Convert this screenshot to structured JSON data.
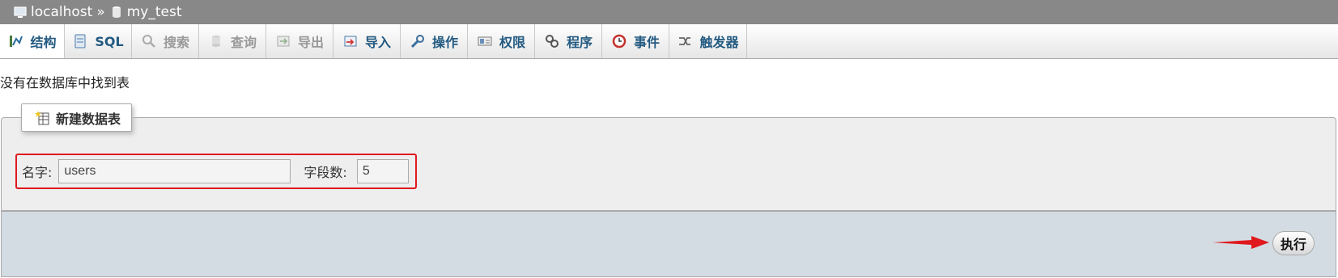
{
  "breadcrumb": {
    "server": "localhost",
    "separator": "»",
    "database": "my_test"
  },
  "tabs": [
    {
      "label": "结构",
      "icon": "structure-icon",
      "enabled": true,
      "active": true
    },
    {
      "label": "SQL",
      "icon": "sql-icon",
      "enabled": true
    },
    {
      "label": "搜索",
      "icon": "search-icon",
      "enabled": false
    },
    {
      "label": "查询",
      "icon": "query-icon",
      "enabled": false
    },
    {
      "label": "导出",
      "icon": "export-icon",
      "enabled": false
    },
    {
      "label": "导入",
      "icon": "import-icon",
      "enabled": true
    },
    {
      "label": "操作",
      "icon": "wrench-icon",
      "enabled": true
    },
    {
      "label": "权限",
      "icon": "privileges-icon",
      "enabled": true
    },
    {
      "label": "程序",
      "icon": "routines-icon",
      "enabled": true
    },
    {
      "label": "事件",
      "icon": "clock-icon",
      "enabled": true
    },
    {
      "label": "触发器",
      "icon": "triggers-icon",
      "enabled": true
    }
  ],
  "message": "没有在数据库中找到表",
  "create_table": {
    "legend": "新建数据表",
    "name_label": "名字:",
    "name_value": "users",
    "columns_label": "字段数:",
    "columns_value": "5"
  },
  "footer": {
    "go_label": "执行"
  },
  "colors": {
    "breadcrumb_bg": "#888888",
    "tab_text": "#235a81",
    "tab_disabled": "#999999",
    "highlight_red": "#e0191e",
    "footer_bg": "#d3dce3"
  }
}
